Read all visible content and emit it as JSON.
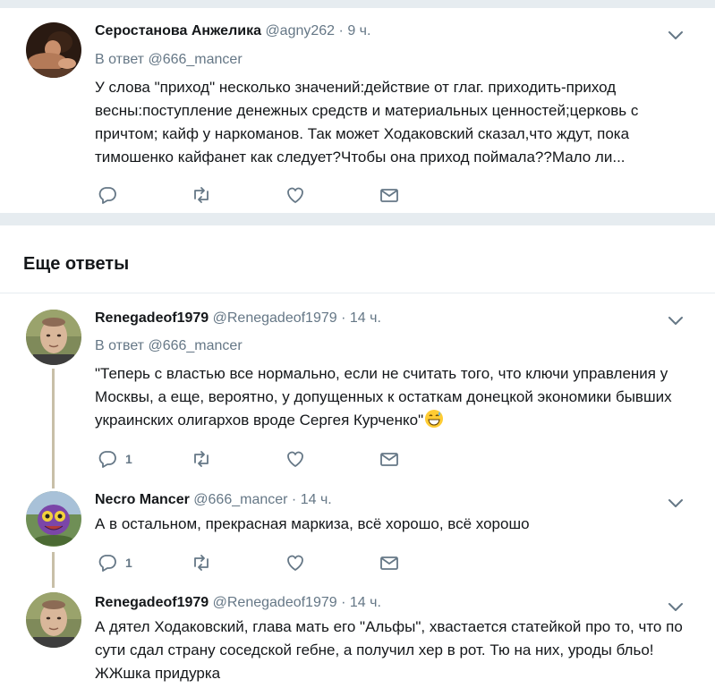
{
  "colors": {
    "text": "#14171a",
    "secondary": "#657786",
    "divider": "#e6ecf0",
    "thread_line": "#c8bfa8"
  },
  "first_tweet": {
    "name": "Серостанова Анжелика",
    "handle": "@agny262",
    "separator": "·",
    "time": "9 ч.",
    "reply_prefix": "В ответ",
    "reply_to": "@666_mancer",
    "text": "У слова \"приход\" несколько значений:действие от глаг. приходить-приход весны:поступление денежных средств и материальных ценностей;церковь с причтом; кайф у наркоманов. Так может Ходаковский сказал,что ждут, пока тимошенко кайфанет как следует?Чтобы она приход поймала??Мало ли...",
    "avatar_icon": "profile-photo-icon"
  },
  "section": {
    "title": "Еще ответы"
  },
  "replies": [
    {
      "name": "Renegadeof1979",
      "handle": "@Renegadeof1979",
      "separator": "·",
      "time": "14 ч.",
      "reply_prefix": "В ответ",
      "reply_to": "@666_mancer",
      "text": "\"Теперь с властью все нормально, если не считать того, что ключи управления у Москвы, а еще, вероятно, у допущенных к остаткам донецкой экономики бывших украинских олигархов вроде Сергея Курченко\"",
      "emoji": "grinning-sweat-emoji",
      "reply_count": "1"
    },
    {
      "name": "Necro Mancer",
      "handle": "@666_mancer",
      "separator": "·",
      "time": "14 ч.",
      "text": "А в остальном, прекрасная маркиза, всё хорошо, всё хорошо",
      "reply_count": "1"
    },
    {
      "name": "Renegadeof1979",
      "handle": "@Renegadeof1979",
      "separator": "·",
      "time": "14 ч.",
      "text": "А дятел Ходаковский, глава мать его \"Альфы\", хвастается статейкой про то, что по сути сдал страну соседской гебне, а получил хер в рот. Тю на них, уроды бльо! ЖЖшка придурка"
    }
  ],
  "icons": {
    "reply": "reply-icon",
    "retweet": "retweet-icon",
    "like": "heart-icon",
    "message": "envelope-icon",
    "menu": "chevron-down-icon"
  }
}
